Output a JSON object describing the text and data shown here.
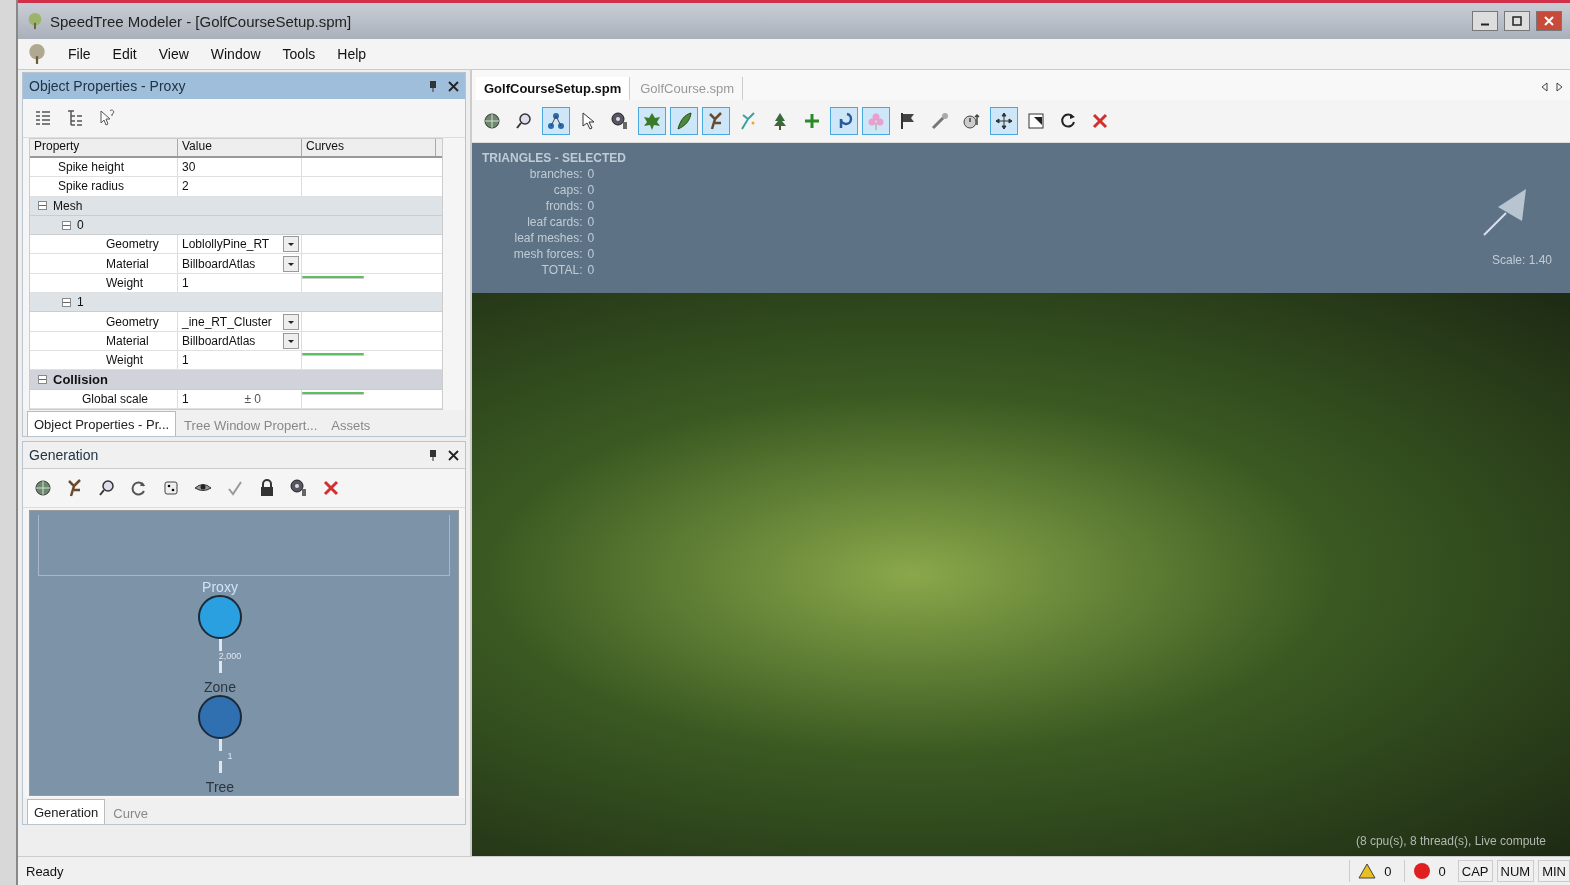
{
  "window": {
    "title": "SpeedTree Modeler - [GolfCourseSetup.spm]"
  },
  "menu": [
    "File",
    "Edit",
    "View",
    "Window",
    "Tools",
    "Help"
  ],
  "object_properties": {
    "title": "Object Properties - Proxy",
    "toolbar": [
      {
        "kind": "categorized",
        "on": false
      },
      {
        "kind": "tree",
        "on": false
      },
      {
        "kind": "help",
        "on": false
      }
    ],
    "columns": [
      "Property",
      "Value",
      "Curves"
    ],
    "rows": [
      {
        "kind": "prop",
        "name": "Spike height",
        "value": "30"
      },
      {
        "kind": "prop",
        "name": "Spike radius",
        "value": "2"
      },
      {
        "kind": "group",
        "name": "Mesh",
        "expanded": true,
        "children": [
          {
            "kind": "group",
            "name": "0",
            "expanded": true,
            "children": [
              {
                "kind": "prop",
                "name": "Geometry",
                "value": "LoblollyPine_RT",
                "dropdown": true
              },
              {
                "kind": "prop",
                "name": "Material",
                "value": "BillboardAtlas",
                "dropdown": true
              },
              {
                "kind": "prop",
                "name": "Weight",
                "value": "1",
                "curve": true
              }
            ]
          },
          {
            "kind": "group",
            "name": "1",
            "expanded": true,
            "children": [
              {
                "kind": "prop",
                "name": "Geometry",
                "value": "_ine_RT_Cluster",
                "dropdown": true
              },
              {
                "kind": "prop",
                "name": "Material",
                "value": "BillboardAtlas",
                "dropdown": true
              },
              {
                "kind": "prop",
                "name": "Weight",
                "value": "1",
                "curve": true
              }
            ]
          }
        ]
      },
      {
        "kind": "category",
        "name": "Collision",
        "expanded": true,
        "children": [
          {
            "kind": "prop",
            "name": "Global scale",
            "value": "1",
            "variance": "± 0",
            "curve": true
          }
        ]
      }
    ],
    "tabs": [
      {
        "label": "Object Properties - Pr...",
        "selected": true
      },
      {
        "label": "Tree Window Propert...",
        "selected": false
      },
      {
        "label": "Assets",
        "selected": false
      }
    ]
  },
  "generation": {
    "title": "Generation",
    "toolbar": [
      {
        "kind": "globe"
      },
      {
        "kind": "branch"
      },
      {
        "kind": "zoom"
      },
      {
        "kind": "refresh"
      },
      {
        "kind": "dice"
      },
      {
        "kind": "eye"
      },
      {
        "kind": "check"
      },
      {
        "kind": "lock"
      },
      {
        "kind": "gear"
      },
      {
        "kind": "delete"
      }
    ],
    "nodes": [
      {
        "label": "Proxy",
        "color": "#2aa0e0",
        "link": "2,000"
      },
      {
        "label": "Zone",
        "color": "#3070b0",
        "link": "1"
      },
      {
        "label": "Tree"
      }
    ],
    "tabs": [
      {
        "label": "Generation",
        "selected": true
      },
      {
        "label": "Curve",
        "selected": false
      }
    ]
  },
  "document_tabs": [
    {
      "label": "GolfCourseSetup.spm",
      "selected": true
    },
    {
      "label": "GolfCourse.spm",
      "selected": false
    }
  ],
  "viewport_toolbar": [
    {
      "kind": "globe",
      "on": false
    },
    {
      "kind": "zoom",
      "on": false
    },
    {
      "kind": "nodes",
      "on": true
    },
    {
      "kind": "pointer",
      "on": false
    },
    {
      "kind": "gear",
      "on": false
    },
    {
      "kind": "leaf",
      "on": true
    },
    {
      "kind": "frond",
      "on": true
    },
    {
      "kind": "branch",
      "on": true
    },
    {
      "kind": "sparkle",
      "on": false
    },
    {
      "kind": "tree",
      "on": false
    },
    {
      "kind": "plus",
      "on": false
    },
    {
      "kind": "hook",
      "on": true
    },
    {
      "kind": "flower",
      "on": true
    },
    {
      "kind": "flag",
      "on": false
    },
    {
      "kind": "tool",
      "on": false
    },
    {
      "kind": "stopwatch",
      "on": false
    },
    {
      "kind": "move",
      "on": true
    },
    {
      "kind": "resize",
      "on": false
    },
    {
      "kind": "rotate",
      "on": false
    },
    {
      "kind": "delete",
      "on": false
    }
  ],
  "viewport": {
    "stats_title": "TRIANGLES - SELECTED",
    "stats": [
      {
        "label": "branches:",
        "value": "0"
      },
      {
        "label": "caps:",
        "value": "0"
      },
      {
        "label": "fronds:",
        "value": "0"
      },
      {
        "label": "leaf cards:",
        "value": "0"
      },
      {
        "label": "leaf meshes:",
        "value": "0"
      },
      {
        "label": "mesh forces:",
        "value": "0"
      },
      {
        "label": "TOTAL:",
        "value": "0"
      }
    ],
    "scale": "Scale: 1.40",
    "info": "(8 cpu(s), 8 thread(s), Live compute"
  },
  "status_bar": {
    "text": "Ready",
    "warnings": "0",
    "errors": "0",
    "indicators": [
      "CAP",
      "NUM",
      "MIN"
    ]
  }
}
